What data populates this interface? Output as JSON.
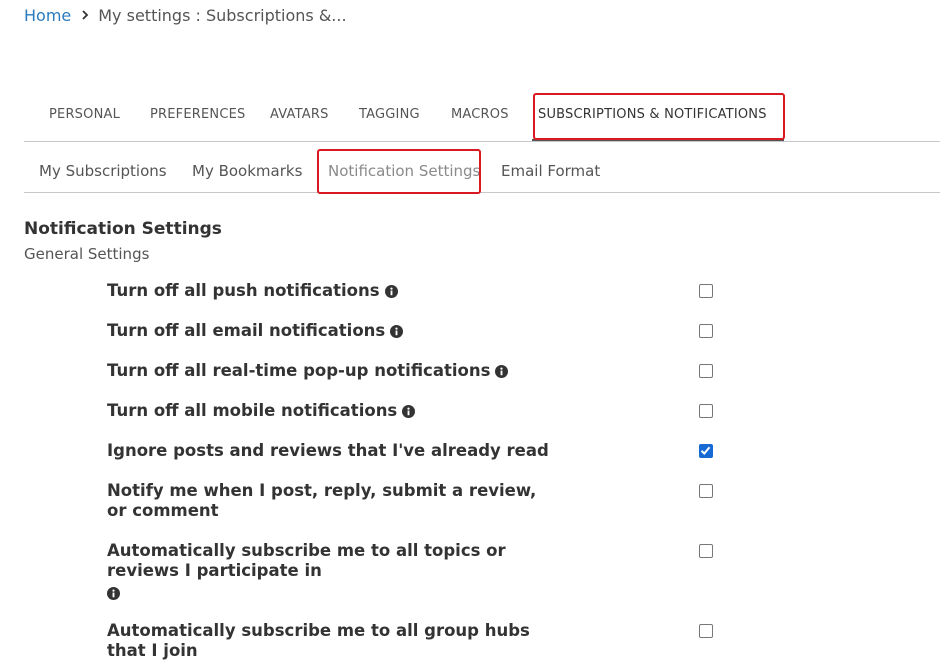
{
  "breadcrumb": {
    "home": "Home",
    "current": "My settings : Subscriptions &..."
  },
  "main_tabs": [
    {
      "label": "PERSONAL"
    },
    {
      "label": "PREFERENCES"
    },
    {
      "label": "AVATARS"
    },
    {
      "label": "TAGGING"
    },
    {
      "label": "MACROS"
    },
    {
      "label": "SUBSCRIPTIONS & NOTIFICATIONS",
      "active": true
    }
  ],
  "sub_tabs": [
    {
      "label": "My Subscriptions"
    },
    {
      "label": "My Bookmarks"
    },
    {
      "label": "Notification Settings",
      "active": true
    },
    {
      "label": "Email Format"
    }
  ],
  "section": {
    "title": "Notification Settings",
    "subtitle": "General Settings"
  },
  "settings": [
    {
      "label": "Turn off all push notifications",
      "info": true,
      "checked": false
    },
    {
      "label": "Turn off all email notifications",
      "info": true,
      "checked": false
    },
    {
      "label": "Turn off all real-time pop-up notifications",
      "info": true,
      "checked": false
    },
    {
      "label": "Turn off all mobile notifications",
      "info": true,
      "checked": false
    },
    {
      "label": "Ignore posts and reviews that I've already read",
      "info": false,
      "checked": true
    },
    {
      "label": "Notify me when I post, reply, submit a review, or comment",
      "info": false,
      "checked": false
    },
    {
      "label": "Automatically subscribe me to all topics or reviews I participate in",
      "info": true,
      "checked": false
    },
    {
      "label": "Automatically subscribe me to all group hubs that I join",
      "info": false,
      "checked": false
    }
  ],
  "colors": {
    "link": "#2a7bbd",
    "highlight": "#d9191f",
    "checkbox_checked": "#1769d4"
  },
  "icons": {
    "breadcrumb_separator": "chevron-right-icon",
    "info": "info-circle-icon",
    "check": "check-icon"
  }
}
